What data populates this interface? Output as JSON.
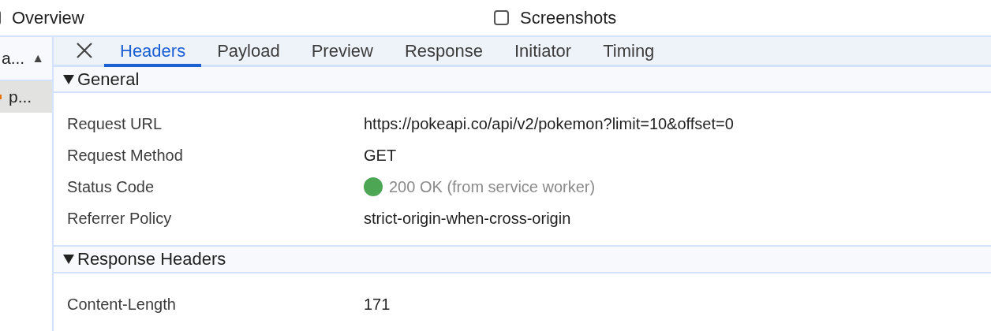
{
  "toolbar": {
    "checkboxes": [
      {
        "label": "Overview",
        "checked": false
      },
      {
        "label": "Screenshots",
        "checked": false
      }
    ]
  },
  "request_list": {
    "header": {
      "label": "a...",
      "sort_indicator": "▲"
    },
    "rows": [
      {
        "label": "p...",
        "selected": true,
        "color": "#e8710a"
      }
    ]
  },
  "details": {
    "tabs": [
      {
        "label": "Headers",
        "selected": true
      },
      {
        "label": "Payload",
        "selected": false
      },
      {
        "label": "Preview",
        "selected": false
      },
      {
        "label": "Response",
        "selected": false
      },
      {
        "label": "Initiator",
        "selected": false
      },
      {
        "label": "Timing",
        "selected": false
      }
    ],
    "sections": [
      {
        "title": "General",
        "expanded": true,
        "rows": [
          {
            "kind": "text",
            "name": "Request URL",
            "value": "https://pokeapi.co/api/v2/pokemon?limit=10&offset=0"
          },
          {
            "kind": "text",
            "name": "Request Method",
            "value": "GET"
          },
          {
            "kind": "status",
            "name": "Status Code",
            "value": "200 OK (from service worker)",
            "color": "#4ca654"
          },
          {
            "kind": "text",
            "name": "Referrer Policy",
            "value": "strict-origin-when-cross-origin"
          }
        ]
      },
      {
        "title": "Response Headers",
        "expanded": true,
        "rows": [
          {
            "kind": "text",
            "name": "Content-Length",
            "value": "171"
          }
        ]
      }
    ]
  }
}
